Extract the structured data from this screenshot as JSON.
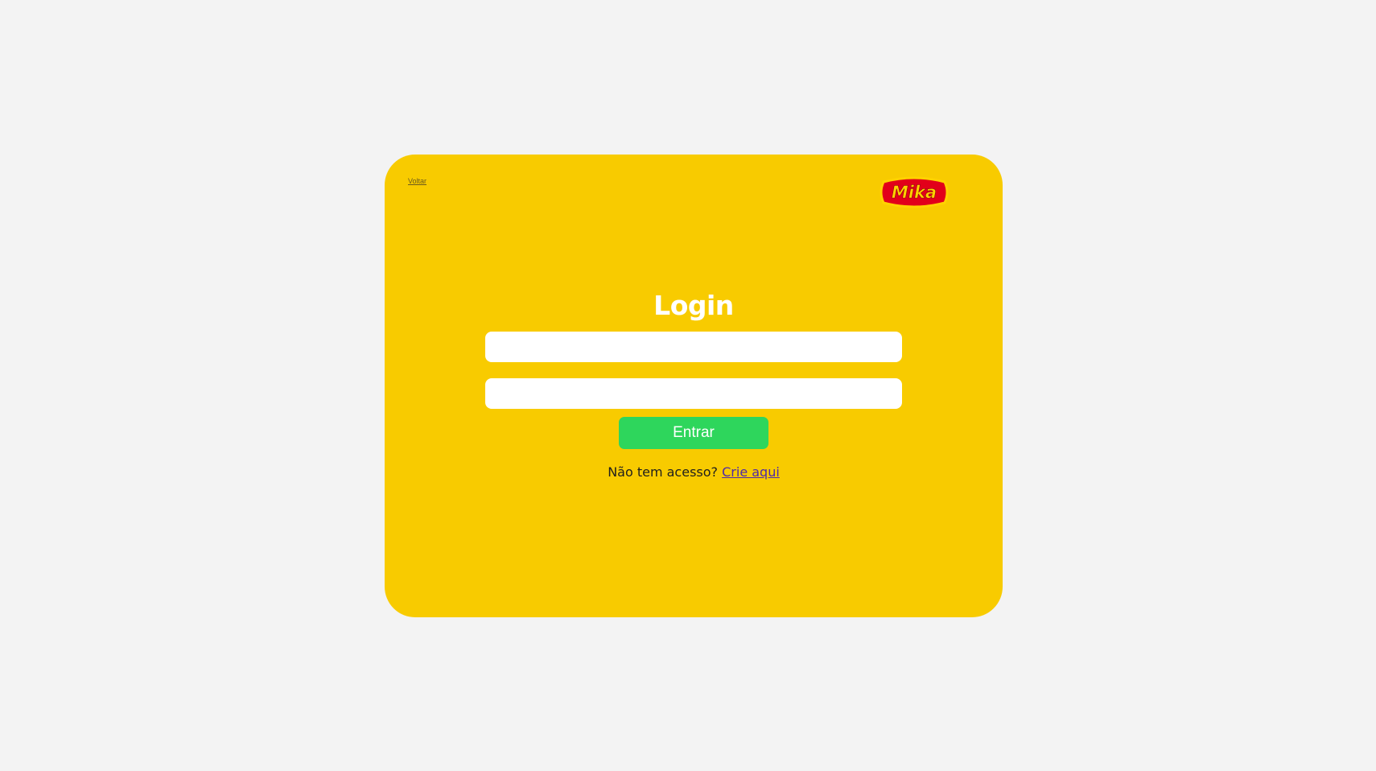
{
  "nav": {
    "back_label": "Voltar"
  },
  "brand": {
    "logo_name": "mika-logo",
    "logo_text": "Mika"
  },
  "form": {
    "title": "Login",
    "username_value": "",
    "password_value": "",
    "submit_label": "Entrar"
  },
  "signup": {
    "prompt": "Não tem acesso?",
    "link_label": "Crie aqui"
  },
  "colors": {
    "page_bg": "#f3f3f3",
    "card_bg": "#f8cb00",
    "submit_bg": "#2ed65c",
    "link": "#4f2aa8",
    "logo_red": "#e2001a",
    "logo_yellow": "#ffd200"
  }
}
